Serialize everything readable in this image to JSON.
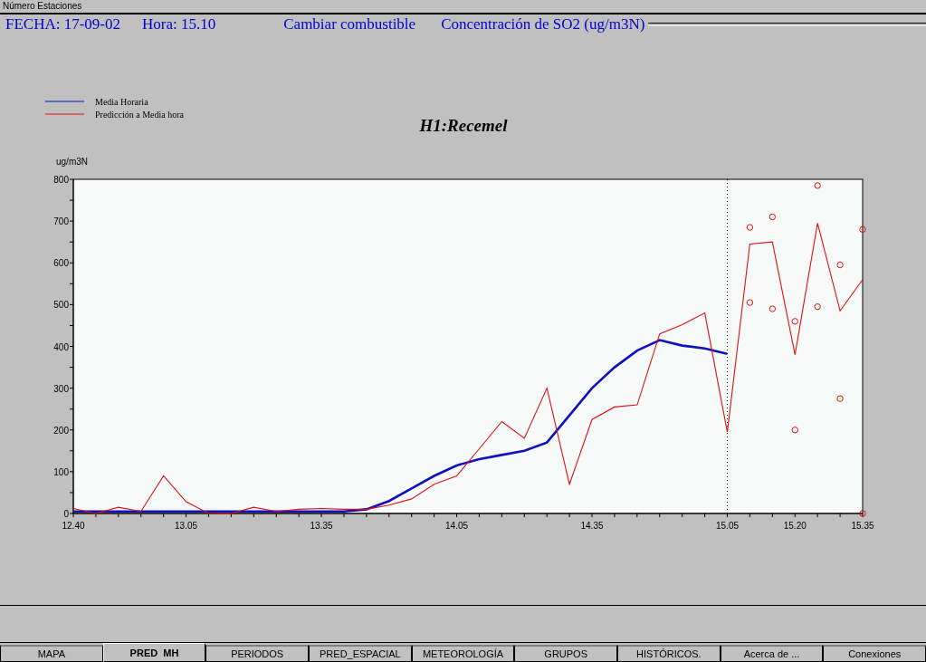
{
  "window": {
    "title": "Número Estaciones"
  },
  "header": {
    "fields": [
      "FECHA: 17-09-02",
      "Hora: 15.10",
      "Cambiar combustible",
      "Concentración de SO2 (ug/m3N)"
    ]
  },
  "chart": {
    "chart_data": {
      "type": "line",
      "title": "H1:Recemel",
      "ylabel": "ug/m3N",
      "categories": [
        "12.40",
        null,
        null,
        null,
        null,
        "13.05",
        null,
        null,
        null,
        null,
        null,
        "13.35",
        null,
        null,
        null,
        null,
        null,
        "14.05",
        null,
        null,
        null,
        null,
        null,
        "14.35",
        null,
        null,
        null,
        null,
        null,
        "15.05",
        null,
        null,
        "15.20",
        null,
        null,
        "15.35"
      ],
      "ylim": [
        0,
        800
      ],
      "yticks": [
        0,
        100,
        200,
        300,
        400,
        500,
        600,
        700,
        800
      ],
      "series": [
        {
          "name": "Media Horaria",
          "color": "#1010c0",
          "values": [
            5,
            5,
            5,
            5,
            5,
            5,
            5,
            5,
            5,
            5,
            5,
            5,
            5,
            10,
            30,
            60,
            90,
            115,
            130,
            140,
            150,
            170,
            235,
            300,
            350,
            390,
            415,
            402,
            395,
            382,
            null,
            null,
            null,
            null,
            null,
            null
          ]
        },
        {
          "name": "Predicción a Media hora",
          "color": "#e01010",
          "values": [
            12,
            0,
            15,
            5,
            90,
            28,
            0,
            0,
            15,
            5,
            10,
            12,
            10,
            10,
            20,
            35,
            70,
            90,
            155,
            220,
            180,
            300,
            70,
            225,
            255,
            260,
            430,
            452,
            480,
            195,
            645,
            650,
            380,
            695,
            485,
            560
          ]
        },
        {
          "color": "#e01010",
          "type": "scatter",
          "values": [
            null,
            null,
            null,
            null,
            null,
            null,
            null,
            null,
            null,
            null,
            null,
            null,
            null,
            null,
            null,
            null,
            null,
            null,
            null,
            null,
            null,
            null,
            null,
            null,
            null,
            null,
            null,
            null,
            null,
            null,
            685,
            710,
            460,
            785,
            595,
            680
          ]
        },
        {
          "color": "#e01010",
          "type": "scatter",
          "values": [
            null,
            null,
            null,
            null,
            null,
            null,
            null,
            null,
            null,
            null,
            null,
            null,
            null,
            null,
            null,
            null,
            null,
            null,
            null,
            null,
            null,
            null,
            null,
            null,
            null,
            null,
            null,
            null,
            null,
            null,
            505,
            490,
            200,
            495,
            275,
            0
          ]
        }
      ],
      "ref_lines": [
        {
          "axis": "x",
          "value": "15.05"
        }
      ],
      "legend": "top-left"
    }
  },
  "tabs": [
    {
      "label": "MAPA",
      "selected": false
    },
    {
      "label": "PRED  MH",
      "selected": true
    },
    {
      "label": "PERIODOS",
      "selected": false
    },
    {
      "label": "PRED_ESPACIAL",
      "selected": false
    },
    {
      "label": "METEOROLOGÍA",
      "selected": false
    },
    {
      "label": "GRUPOS",
      "selected": false
    },
    {
      "label": "HISTÓRICOS.",
      "selected": false
    },
    {
      "label": "Acerca de ...",
      "selected": false
    },
    {
      "label": "Conexiones",
      "selected": false
    }
  ]
}
